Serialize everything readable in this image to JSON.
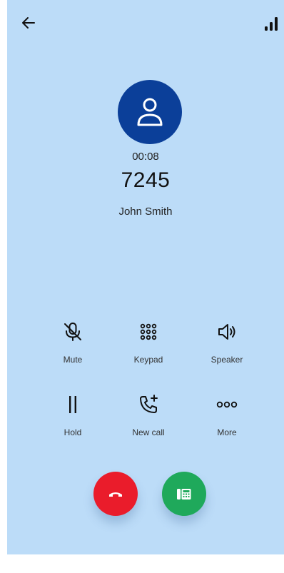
{
  "call": {
    "timer": "00:08",
    "number": "7245",
    "contact_name": "John Smith"
  },
  "actions": {
    "mute": {
      "label": "Mute",
      "icon": "mic-off-icon"
    },
    "keypad": {
      "label": "Keypad",
      "icon": "dialpad-icon"
    },
    "speaker": {
      "label": "Speaker",
      "icon": "speaker-icon"
    },
    "hold": {
      "label": "Hold",
      "icon": "pause-icon"
    },
    "new_call": {
      "label": "New call",
      "icon": "add-call-icon"
    },
    "more": {
      "label": "More",
      "icon": "more-horizontal-icon"
    }
  },
  "colors": {
    "background": "#bcdcf8",
    "avatar": "#0b3f99",
    "end_call": "#ea1c2b",
    "dialpad_button": "#1fa95b"
  }
}
